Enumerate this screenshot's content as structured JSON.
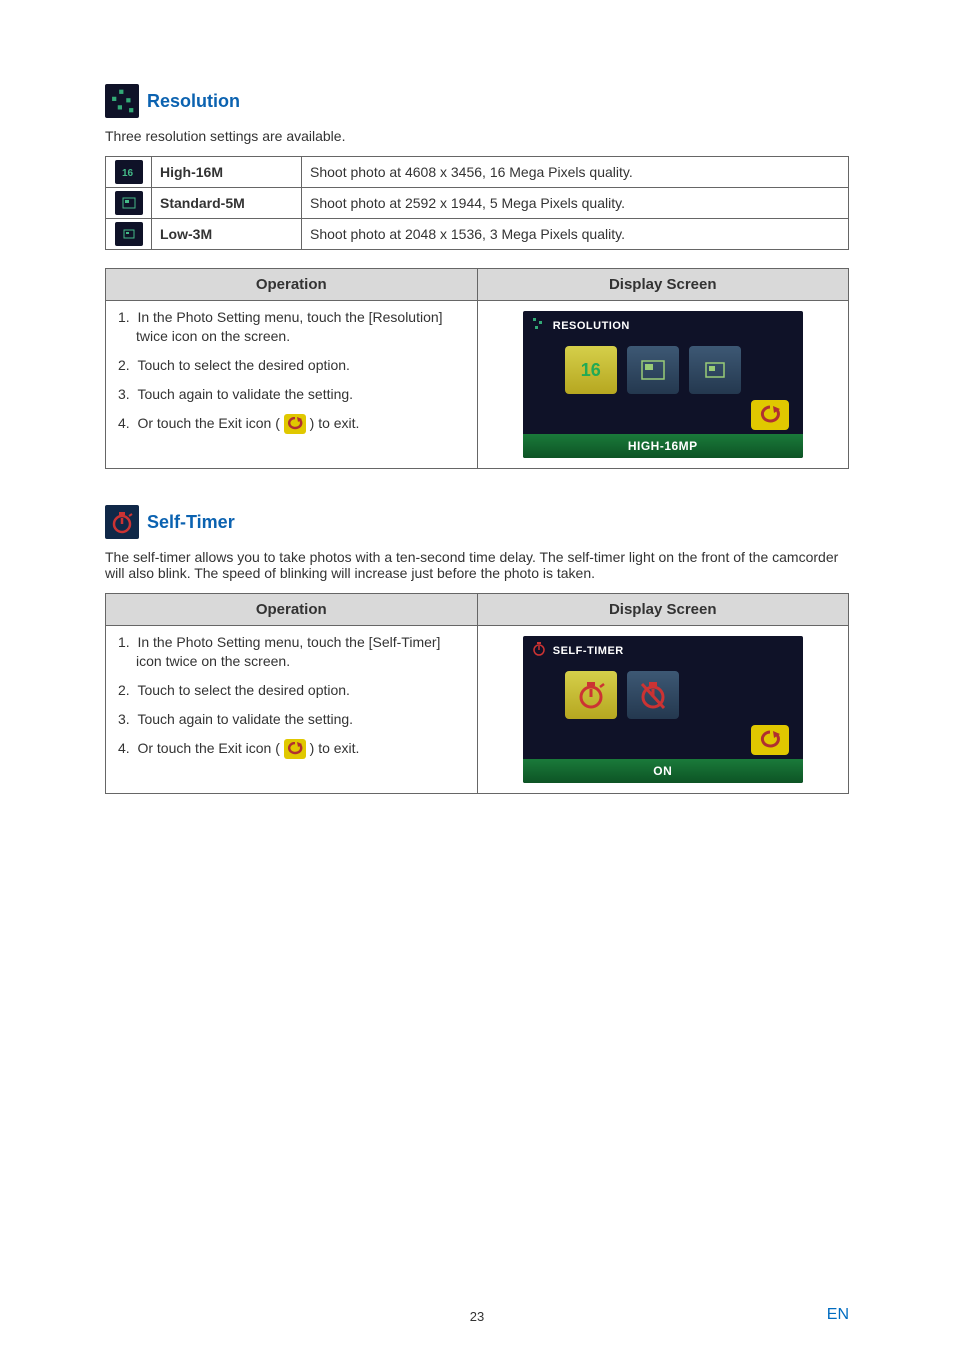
{
  "resolution": {
    "title": "Resolution",
    "intro": "Three resolution settings are available.",
    "rows": [
      {
        "name": "High-16M",
        "desc": "Shoot photo at 4608 x 3456, 16 Mega Pixels quality."
      },
      {
        "name": "Standard-5M",
        "desc": "Shoot photo at 2592 x 1944, 5 Mega Pixels quality."
      },
      {
        "name": "Low-3M",
        "desc": "Shoot photo at 2048 x 1536, 3 Mega Pixels quality."
      }
    ],
    "op_header": "Operation",
    "ds_header": "Display Screen",
    "steps": [
      "In the Photo Setting menu, touch the [Resolution] twice icon on the screen.",
      "Touch to select the desired option.",
      "Touch again to validate the setting.",
      "Or touch the Exit icon (",
      ") to exit."
    ],
    "screen": {
      "header": "RESOLUTION",
      "selected_label": "16",
      "footer": "HIGH-16MP"
    }
  },
  "selftimer": {
    "title": "Self-Timer",
    "intro": "The self-timer allows you to take photos with a ten-second time delay. The self-timer light on the front of the camcorder will also blink. The speed of blinking will increase just before the photo is taken.",
    "op_header": "Operation",
    "ds_header": "Display Screen",
    "steps": [
      "In the Photo Setting menu, touch the [Self-Timer] icon twice on the screen.",
      "Touch to select the desired option.",
      "Touch again to validate the setting.",
      "Or touch the Exit icon (",
      ") to exit."
    ],
    "screen": {
      "header": "SELF-TIMER",
      "footer": "ON"
    }
  },
  "footer": {
    "page": "23",
    "lang": "EN"
  }
}
